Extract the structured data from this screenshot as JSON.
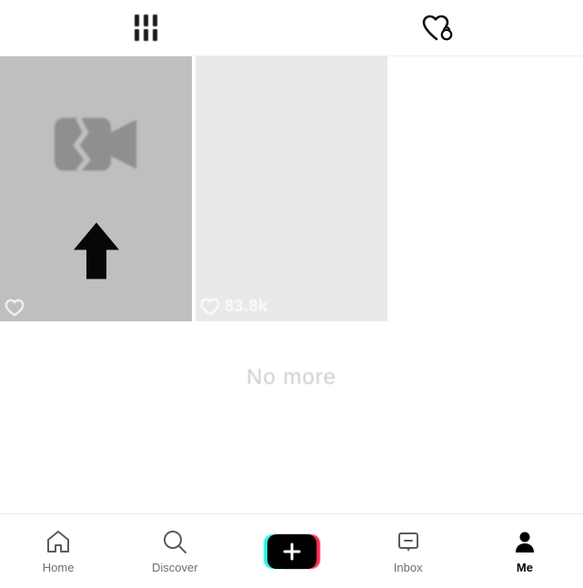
{
  "top_tabs": {
    "grid_label": "grid",
    "liked_label": "liked"
  },
  "grid": {
    "tiles": [
      {
        "likes": ""
      },
      {
        "likes": "83.8k"
      }
    ]
  },
  "status": {
    "no_more": "No more"
  },
  "nav": {
    "home": "Home",
    "discover": "Discover",
    "inbox": "Inbox",
    "me": "Me"
  }
}
